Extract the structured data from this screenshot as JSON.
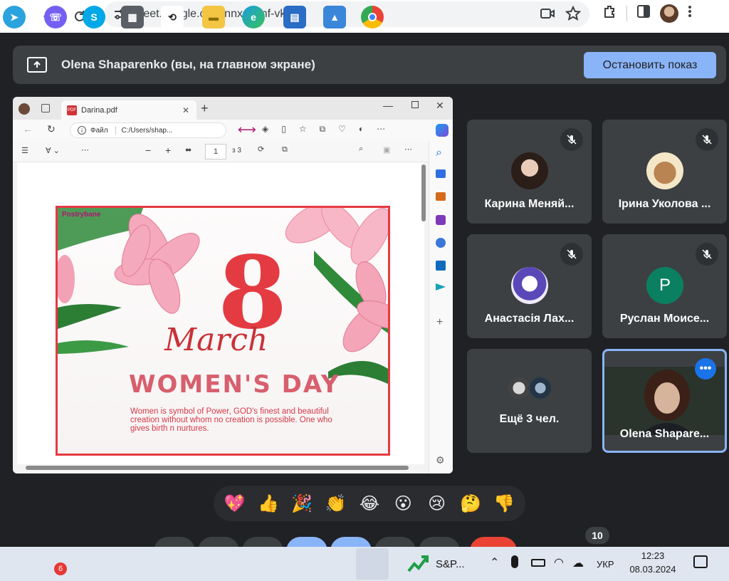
{
  "browser": {
    "url": "meet.google.com/nnx-xymf-vki"
  },
  "banner": {
    "title": "Olena Shaparenko (вы, на главном экране)",
    "stop_label": "Остановить показ"
  },
  "shared_window": {
    "tab_title": "Darina.pdf",
    "address_prefix": "Файл",
    "address_path": "C:/Users/shap...",
    "page_number": "1",
    "page_total": "з 3",
    "card": {
      "logo": "Postrybane",
      "big_number": "8",
      "month": "March",
      "headline": "WOMEN'S DAY",
      "body": "Women is symbol of Power, GOD's finest and beautiful creation without whom no creation is possible. One who gives birth n nurtures."
    }
  },
  "participants": [
    {
      "name": "Карина Меняй...",
      "muted": true
    },
    {
      "name": "Ірина Уколова ...",
      "muted": true
    },
    {
      "name": "Анастасія Лах...",
      "muted": true
    },
    {
      "name": "Руслан Моисе...",
      "muted": true,
      "initial": "P"
    },
    {
      "name": "Ещё 3 чел."
    },
    {
      "name": "Olena Shapare..."
    }
  ],
  "reactions": [
    "💖",
    "👍",
    "🎉",
    "👏",
    "😂",
    "😮",
    "😢",
    "🤔",
    "👎"
  ],
  "participant_count": "10",
  "taskbar": {
    "viber_badge": "6",
    "stock_label": "S&P...",
    "language": "УКР",
    "time": "12:23",
    "date": "08.03.2024"
  },
  "colors": {
    "meet_bg": "#202124",
    "tile_bg": "#3c4043",
    "accent": "#8ab4f8",
    "card_red": "#e33b41"
  }
}
